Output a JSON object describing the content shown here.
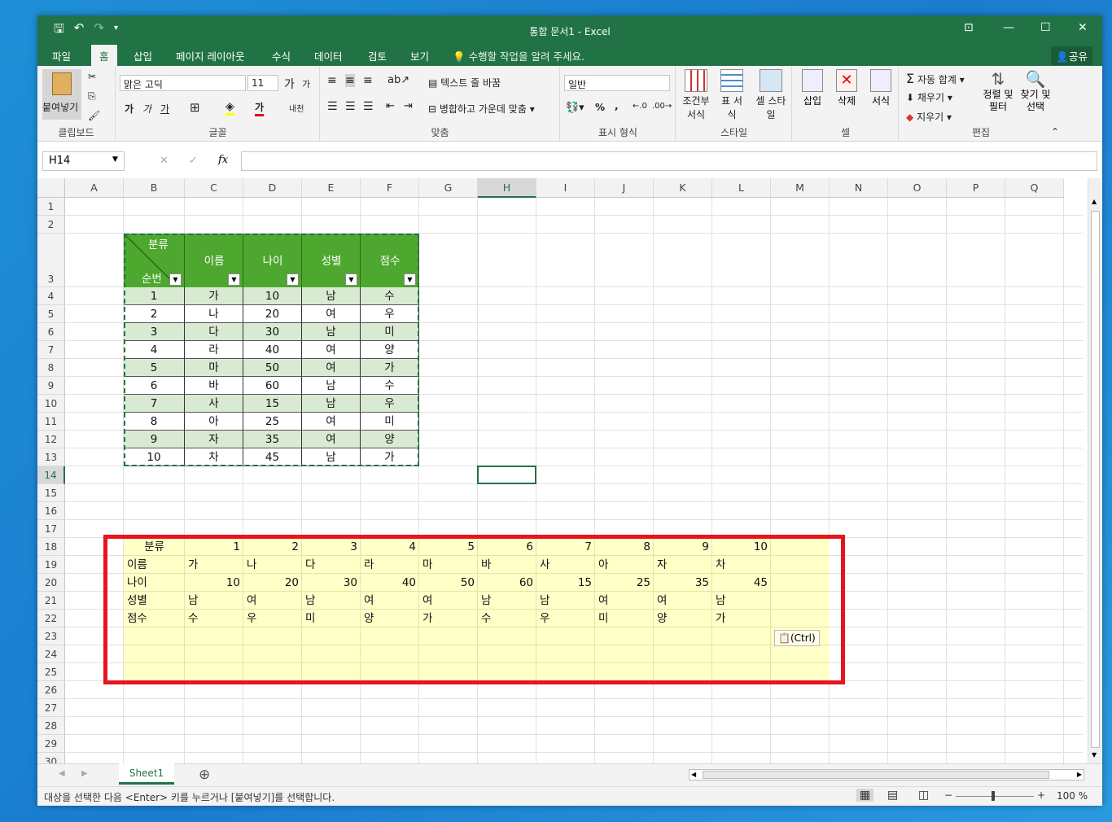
{
  "window": {
    "title": "통합 문서1 - Excel"
  },
  "tabs": [
    "파일",
    "홈",
    "삽입",
    "페이지 레이아웃",
    "수식",
    "데이터",
    "검토",
    "보기"
  ],
  "active_tab": "홈",
  "tell_me": "수행할 작업을 알려 주세요.",
  "share": "공유",
  "ribbon": {
    "clipboard": {
      "label": "클립보드",
      "paste": "붙여넣기"
    },
    "font": {
      "label": "글꼴",
      "name": "맑은 고딕",
      "size": "11",
      "grow": "가",
      "shrink": "가",
      "bold": "가",
      "italic": "가",
      "underline": "가",
      "font_color": "가",
      "phonetic": "내천"
    },
    "align": {
      "label": "맞춤",
      "wrap": "텍스트 줄 바꿈",
      "merge": "병합하고 가운데 맞춤"
    },
    "number": {
      "label": "표시 형식",
      "format": "일반",
      "percent": "%",
      "comma": ","
    },
    "styles": {
      "label": "스타일",
      "conditional": "조건부 서식",
      "table": "표 서식",
      "cell": "셀 스타일"
    },
    "cells": {
      "label": "셀",
      "insert": "삽입",
      "delete": "삭제",
      "format": "서식"
    },
    "editing": {
      "label": "편집",
      "autosum": "자동 합계",
      "fill": "채우기",
      "clear": "지우기",
      "sort": "정렬 및 필터",
      "find": "찾기 및 선택"
    }
  },
  "formula_bar": {
    "name_box": "H14",
    "formula": "",
    "fx": "fx"
  },
  "columns": [
    "A",
    "B",
    "C",
    "D",
    "E",
    "F",
    "G",
    "H",
    "I",
    "J",
    "K",
    "L",
    "M",
    "N",
    "O",
    "P",
    "Q"
  ],
  "rows": [
    "1",
    "2",
    "3",
    "4",
    "5",
    "6",
    "7",
    "8",
    "9",
    "10",
    "11",
    "12",
    "13",
    "14",
    "15",
    "16",
    "17",
    "18",
    "19",
    "20",
    "21",
    "22",
    "23",
    "24",
    "25",
    "26",
    "27",
    "28",
    "29",
    "30"
  ],
  "selected_cell": "H14",
  "table": {
    "header_diag_top": "분류",
    "header_diag_bottom": "순번",
    "headers": [
      "이름",
      "나이",
      "성별",
      "점수"
    ],
    "rows": [
      [
        "1",
        "가",
        "10",
        "남",
        "수"
      ],
      [
        "2",
        "나",
        "20",
        "여",
        "우"
      ],
      [
        "3",
        "다",
        "30",
        "남",
        "미"
      ],
      [
        "4",
        "라",
        "40",
        "여",
        "양"
      ],
      [
        "5",
        "마",
        "50",
        "여",
        "가"
      ],
      [
        "6",
        "바",
        "60",
        "남",
        "수"
      ],
      [
        "7",
        "사",
        "15",
        "남",
        "우"
      ],
      [
        "8",
        "아",
        "25",
        "여",
        "미"
      ],
      [
        "9",
        "자",
        "35",
        "여",
        "양"
      ],
      [
        "10",
        "차",
        "45",
        "남",
        "가"
      ]
    ]
  },
  "transposed": {
    "rows": [
      [
        "분류",
        "1",
        "2",
        "3",
        "4",
        "5",
        "6",
        "7",
        "8",
        "9",
        "10"
      ],
      [
        "이름",
        "가",
        "나",
        "다",
        "라",
        "마",
        "바",
        "사",
        "아",
        "자",
        "차"
      ],
      [
        "나이",
        "10",
        "20",
        "30",
        "40",
        "50",
        "60",
        "15",
        "25",
        "35",
        "45"
      ],
      [
        "성별",
        "남",
        "여",
        "남",
        "여",
        "여",
        "남",
        "남",
        "여",
        "여",
        "남"
      ],
      [
        "점수",
        "수",
        "우",
        "미",
        "양",
        "가",
        "수",
        "우",
        "미",
        "양",
        "가"
      ]
    ]
  },
  "paste_options": "(Ctrl)",
  "sheet_tab": "Sheet1",
  "status": {
    "message": "대상을 선택한 다음 <Enter> 키를 누르거나 [붙여넣기]를 선택합니다.",
    "zoom": "100 %"
  },
  "colors": {
    "excel_green": "#217346",
    "table_header": "#4ea72e",
    "band_light": "#d9ead3",
    "paste_fill": "#ffffc8",
    "highlight_red": "#e8141d"
  }
}
